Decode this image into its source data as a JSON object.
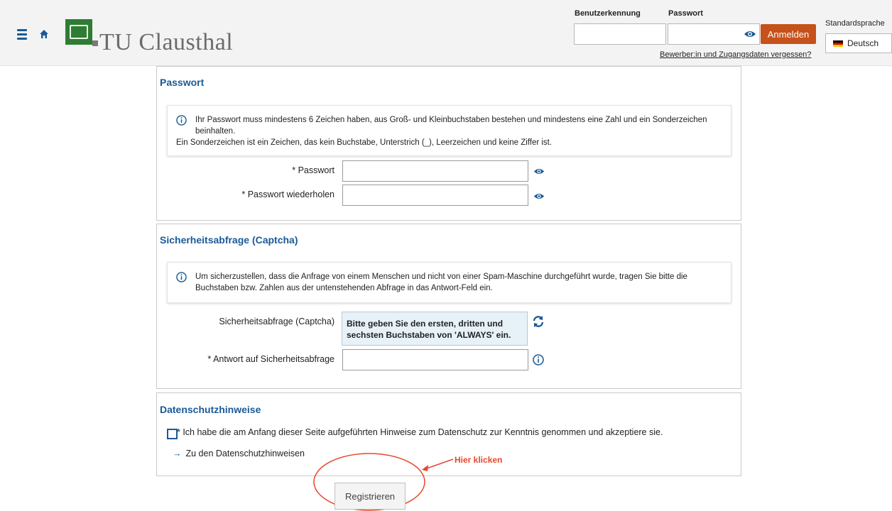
{
  "header": {
    "logo_text": "TU Clausthal",
    "username_label": "Benutzerkennung",
    "password_label": "Passwort",
    "username_value": "",
    "password_value": "",
    "login_button": "Anmelden",
    "forgot_link": "Bewerber:in und Zugangsdaten vergessen?",
    "language_label": "Standardsprache",
    "language_value": "Deutsch"
  },
  "password_section": {
    "title": "Passwort",
    "info_line1": "Ihr Passwort muss mindestens 6 Zeichen haben, aus Groß- und Kleinbuchstaben bestehen und mindestens eine Zahl und ein Sonderzeichen beinhalten.",
    "info_line2": "Ein Sonderzeichen ist ein Zeichen, das kein Buchstabe, Unterstrich (_), Leerzeichen und keine Ziffer ist.",
    "password_label": "* Passwort",
    "password_value": "",
    "repeat_label": "* Passwort wiederholen",
    "repeat_value": ""
  },
  "captcha_section": {
    "title": "Sicherheitsabfrage (Captcha)",
    "info_text": "Um sicherzustellen, dass die Anfrage von einem Menschen und nicht von einer Spam-Maschine durchgeführt wurde, tragen Sie bitte die Buchstaben bzw. Zahlen aus der untenstehenden Abfrage in das Antwort-Feld ein.",
    "captcha_label": "Sicherheitsabfrage (Captcha)",
    "captcha_question": "Bitte geben Sie den ersten, dritten und sechsten Buchstaben von 'ALWAYS' ein.",
    "answer_label": "* Antwort auf Sicherheitsabfrage",
    "answer_value": ""
  },
  "privacy_section": {
    "title": "Datenschutzhinweise",
    "checkbox_text": "* Ich habe die am Anfang dieser Seite aufgeführten Hinweise zum Datenschutz zur Kenntnis genommen und akzeptiere sie.",
    "link_text": "Zu den Datenschutzhinweisen"
  },
  "annotation": {
    "text": "Hier klicken"
  },
  "register_button": "Registrieren",
  "colors": {
    "accent_blue": "#1a5a96",
    "login_orange": "#c6511b",
    "annotation_red": "#e8452b",
    "logo_green": "#2e7d32"
  }
}
